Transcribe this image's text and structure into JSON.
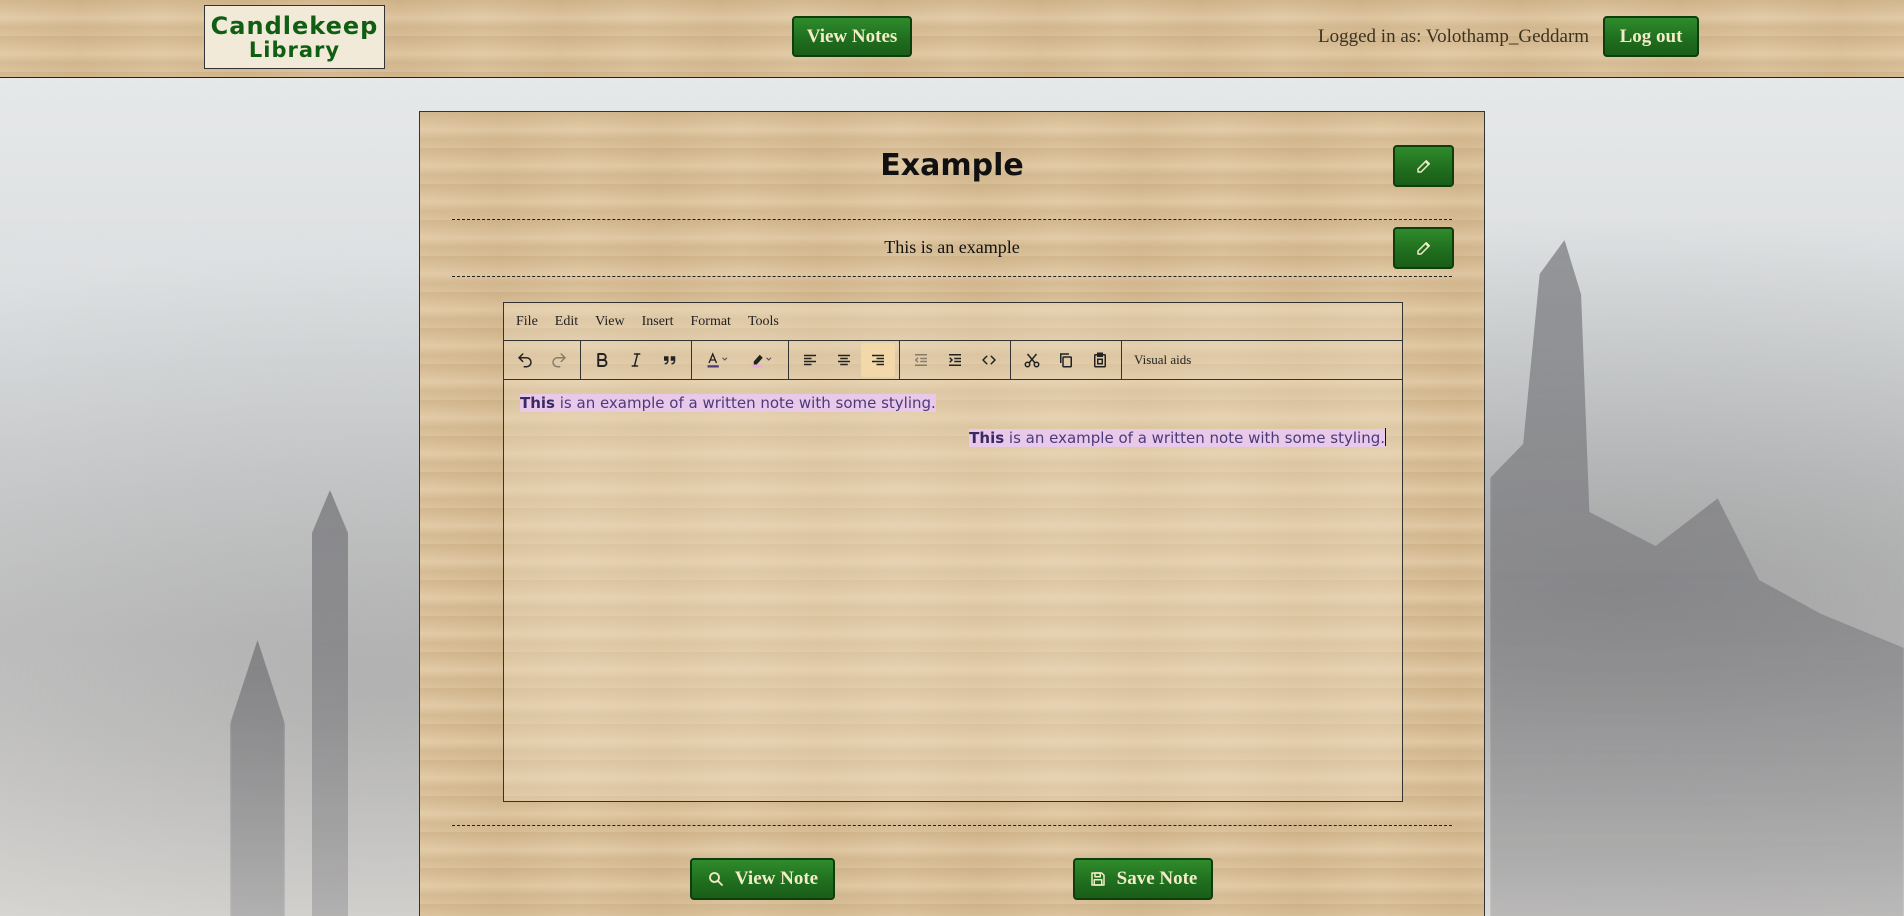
{
  "header": {
    "logo_line1": "Candlekeep",
    "logo_line2": "Library",
    "view_notes_label": "View Notes",
    "logged_in_text": "Logged in as: Volothamp_Geddarm",
    "logout_label": "Log out"
  },
  "note": {
    "title": "Example",
    "description": "This is an example"
  },
  "editor": {
    "menu": [
      "File",
      "Edit",
      "View",
      "Insert",
      "Format",
      "Tools"
    ],
    "toolbar": {
      "visual_aids_label": "Visual aids",
      "active_button": "align-right"
    },
    "content": {
      "line1_bold": "This",
      "line1_rest": " is an example of a written note with some styling.",
      "line2_bold": "This",
      "line2_rest": " is an example of a written note with some styling."
    }
  },
  "actions": {
    "view_note_label": "View Note",
    "save_note_label": "Save Note"
  },
  "colors": {
    "button_green": "#1f6d1e",
    "button_text": "#f4ecc8",
    "logo_green": "#0f5e12",
    "highlight": "#e9c9e9",
    "text_purple": "#4c3a78",
    "active_tool": "#f3d9a9"
  }
}
